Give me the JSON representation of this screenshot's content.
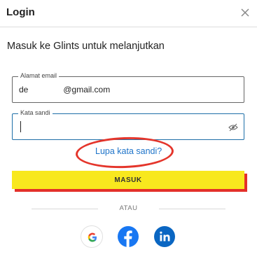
{
  "header": {
    "title": "Login",
    "close_icon": "close-icon"
  },
  "subtitle": "Masuk ke Glints untuk melanjutkan",
  "email": {
    "label": "Alamat email",
    "value_prefix": "de",
    "value_suffix": "@gmail.com"
  },
  "password": {
    "label": "Kata sandi",
    "value": "",
    "toggle_icon": "eye-slash-icon"
  },
  "forgot_link": "Lupa kata sandi?",
  "submit_label": "MASUK",
  "divider_text": "ATAU",
  "social": [
    {
      "name": "google",
      "icon": "google-icon"
    },
    {
      "name": "facebook",
      "icon": "facebook-icon",
      "color": "#1877f2"
    },
    {
      "name": "linkedin",
      "icon": "linkedin-icon",
      "color": "#0a66c2"
    }
  ],
  "colors": {
    "submit_yellow": "#f8e81e",
    "submit_shadow": "#e3302a",
    "link_blue": "#1e74c9",
    "annotation_red": "#e4352b"
  }
}
